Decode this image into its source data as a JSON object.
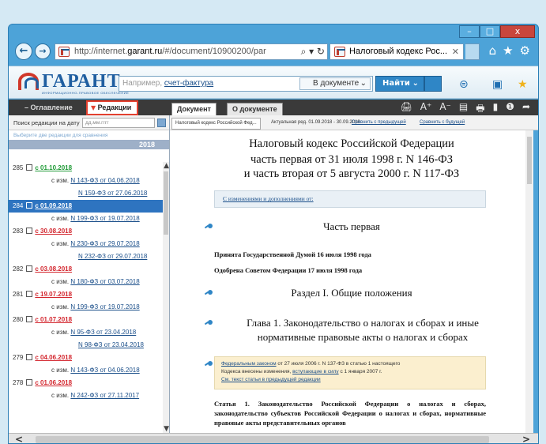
{
  "window": {
    "minimize": "–",
    "maximize": "□",
    "close": "x"
  },
  "nav": {
    "back": "←",
    "forward": "→",
    "url_prefix": "http://internet.",
    "url_domain": "garant.ru",
    "url_path": "/#/document/10900200/par",
    "url_icons": "⌕ ▾ ↻",
    "tab_title": "Налоговый кодекс Рос...",
    "tab_close": "✕",
    "icons": {
      "home": "⌂",
      "favorites": "★",
      "settings": "⚙"
    }
  },
  "toolbar": {
    "logo_text": "ГАРАНТ",
    "logo_sub": "ИНФОРМАЦИОННО-ПРАВОВОЕ ОБЕСПЕЧЕНИЕ",
    "search_placeholder": "Например, ",
    "search_placeholder_link": "счет-фактура",
    "scope": "В документе",
    "scope_chev": "⌄",
    "find": "Найти",
    "find_chev": "⌄"
  },
  "left_tabs": {
    "overview": "– Оглавление",
    "editions_marker": "▼",
    "editions": " Редакции"
  },
  "right_tabs": {
    "document": "Документ",
    "about": "О документе"
  },
  "doc_tools": [
    "🖨",
    "A⁺",
    "A⁻",
    "▤",
    "🖶",
    "▮",
    "❶",
    "➦"
  ],
  "date_filter": {
    "label": "Поиск редакции на дату",
    "placeholder": "дд.мм.гггг"
  },
  "hint": "Выберите две редакции для сравнения",
  "year": "2018",
  "editions": [
    {
      "num": "285",
      "date": "с 01.10.2018",
      "color": "green",
      "changes": [
        "N 143-ФЗ от 04.06.2018",
        "N 159-ФЗ от 27.06.2018"
      ]
    },
    {
      "num": "284",
      "date": "с 01.09.2018",
      "color": "white",
      "selected": true,
      "changes": [
        "N 199-ФЗ от 19.07.2018"
      ]
    },
    {
      "num": "283",
      "date": "с 30.08.2018",
      "color": "red",
      "changes": [
        "N 230-ФЗ от 29.07.2018",
        "N 232-ФЗ от 29.07.2018"
      ]
    },
    {
      "num": "282",
      "date": "с 03.08.2018",
      "color": "red",
      "changes": [
        "N 180-ФЗ от 03.07.2018"
      ]
    },
    {
      "num": "281",
      "date": "с 19.07.2018",
      "color": "red",
      "changes": [
        "N 199-ФЗ от 19.07.2018"
      ]
    },
    {
      "num": "280",
      "date": "с 01.07.2018",
      "color": "red",
      "changes": [
        "N 95-ФЗ от 23.04.2018",
        "N 98-ФЗ от 23.04.2018"
      ]
    },
    {
      "num": "279",
      "date": "с 04.06.2018",
      "color": "red",
      "changes": [
        "N 143-ФЗ от 04.06.2018"
      ]
    },
    {
      "num": "278",
      "date": "с 01.06.2018",
      "color": "red",
      "changes": [
        "N 242-ФЗ от 27.11.2017"
      ]
    }
  ],
  "changes_prefix": "с изм.",
  "doc_tabs": {
    "a": "Налоговый кодекс Российской Фед...",
    "b": "Актуальная ред. 01.09.2018 - 30.09.2018",
    "c": "Сравнить с предыдущей",
    "d": "Сравнить с будущей"
  },
  "document": {
    "title_1": "Налоговый кодекс Российской Федерации",
    "title_2": "часть первая от 31 июля 1998 г. N 146-ФЗ",
    "title_3": "и часть вторая от 5 августа 2000 г. N 117-ФЗ",
    "changes_link": "С изменениями и дополнениями от:",
    "part_1": "Часть первая",
    "adopted": "Принята Государственной Думой 16 июля 1998 года",
    "approved": "Одобрена Советом Федерации 17 июля 1998 года",
    "section_1": "Раздел I. Общие положения",
    "chapter_1_a": "Глава 1. Законодательство о налогах и сборах и иные",
    "chapter_1_b": "нормативные правовые акты о налогах и сборах",
    "note_link_1": "Федеральным законом",
    "note_text_1": " от 27 июля 2006 г. N 137-ФЗ в статью 1 настоящего",
    "note_text_2": "Кодекса внесены изменения, ",
    "note_link_2": "вступающие в силу",
    "note_text_3": " с 1 января 2007 г.",
    "note_link_3": "См. текст статьи в предыдущей редакции",
    "article_1": "Статья 1. Законодательство Российской Федерации о налогах и сборах, законодательство субъектов Российской Федерации о налогах и сборах, нормативные правовые акты представительных органов"
  },
  "scroll": {
    "left": "<",
    "right": ">",
    "up": "▲",
    "down": "▼"
  }
}
